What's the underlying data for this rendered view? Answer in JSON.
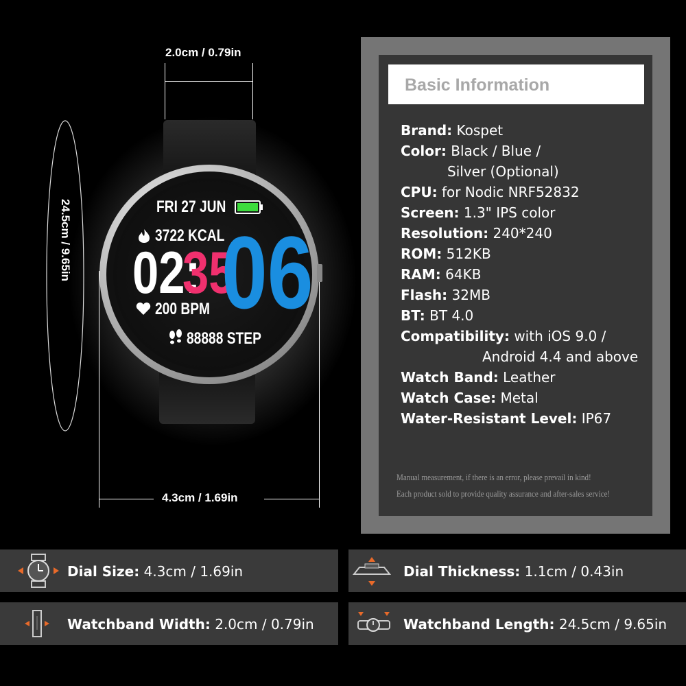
{
  "dimensions": {
    "band_width": "2.0cm / 0.79in",
    "band_length": "24.5cm / 9.65in",
    "dial_width": "4.3cm / 1.69in"
  },
  "watch_face": {
    "date": "FRI 27 JUN",
    "calories": "3722 KCAL",
    "hour": "02:",
    "minute": "35",
    "second": "06",
    "heart_rate": "200 BPM",
    "steps": "88888 STEP",
    "accent_pink": "#f0306e",
    "accent_blue": "#1a8ee0",
    "battery_color": "#3ddc3d"
  },
  "info": {
    "title": "Basic Information",
    "specs": [
      {
        "label": "Brand:",
        "value": "Kospet"
      },
      {
        "label": "Color:",
        "value": "Black / Blue /"
      },
      {
        "label": "",
        "value": "Silver (Optional)"
      },
      {
        "label": "CPU:",
        "value": "for Nodic NRF52832"
      },
      {
        "label": "Screen:",
        "value": "1.3\" IPS color"
      },
      {
        "label": "Resolution:",
        "value": "240*240"
      },
      {
        "label": "ROM:",
        "value": "512KB"
      },
      {
        "label": "RAM:",
        "value": "64KB"
      },
      {
        "label": "Flash:",
        "value": "32MB"
      },
      {
        "label": "BT:",
        "value": "BT 4.0"
      },
      {
        "label": "Compatibility:",
        "value": "with iOS 9.0 /"
      },
      {
        "label": "",
        "value": "Android 4.4 and above"
      },
      {
        "label": "Watch Band:",
        "value": "Leather"
      },
      {
        "label": "Watch Case:",
        "value": "Metal"
      },
      {
        "label": "Water-Resistant Level:",
        "value": "IP67"
      }
    ],
    "note_1": "Manual measurement, if there is an error, please prevail in kind!",
    "note_2": "Each product sold to provide quality assurance and after-sales service!"
  },
  "bars": [
    {
      "label": "Dial Size:",
      "value": "4.3cm / 1.69in",
      "icon": "watch-dial-icon"
    },
    {
      "label": "Dial Thickness:",
      "value": "1.1cm / 0.43in",
      "icon": "dial-thickness-icon"
    },
    {
      "label": "Watchband Width:",
      "value": "2.0cm / 0.79in",
      "icon": "band-width-icon"
    },
    {
      "label": "Watchband Length:",
      "value": "24.5cm / 9.65in",
      "icon": "band-length-icon"
    }
  ],
  "colors": {
    "arrow_orange": "#e86a2a",
    "bar_bg": "#3a3a3a",
    "panel_bg": "#363636"
  }
}
